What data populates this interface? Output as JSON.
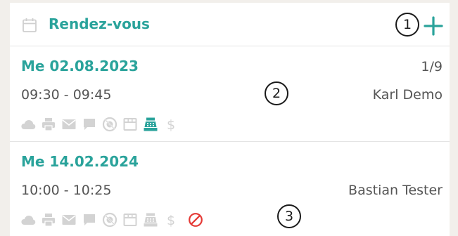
{
  "header": {
    "title": "Rendez-vous",
    "add_marker": "1"
  },
  "appointments": [
    {
      "date": "Me 02.08.2023",
      "counter": "1/9",
      "time": "09:30 - 09:45",
      "person": "Karl Demo",
      "marker": "2",
      "icons": [
        "cloud-icon",
        "printer-icon",
        "mail-icon",
        "chat-icon",
        "no-show-icon",
        "store-icon",
        "cash-register-icon",
        "dollar-icon"
      ],
      "active_icon": "cash-register-icon"
    },
    {
      "date": "Me 14.02.2024",
      "time": "10:00 - 10:25",
      "person": "Bastian Tester",
      "marker": "3",
      "icons": [
        "cloud-icon",
        "printer-icon",
        "mail-icon",
        "chat-icon",
        "no-show-icon",
        "store-icon",
        "cash-register-icon",
        "dollar-icon",
        "cancel-icon"
      ],
      "active_icon": "cancel-icon"
    }
  ],
  "colors": {
    "accent": "#2aa39b",
    "icon_inactive": "#d3d3d3",
    "cancel": "#e53935",
    "text": "#555555"
  }
}
